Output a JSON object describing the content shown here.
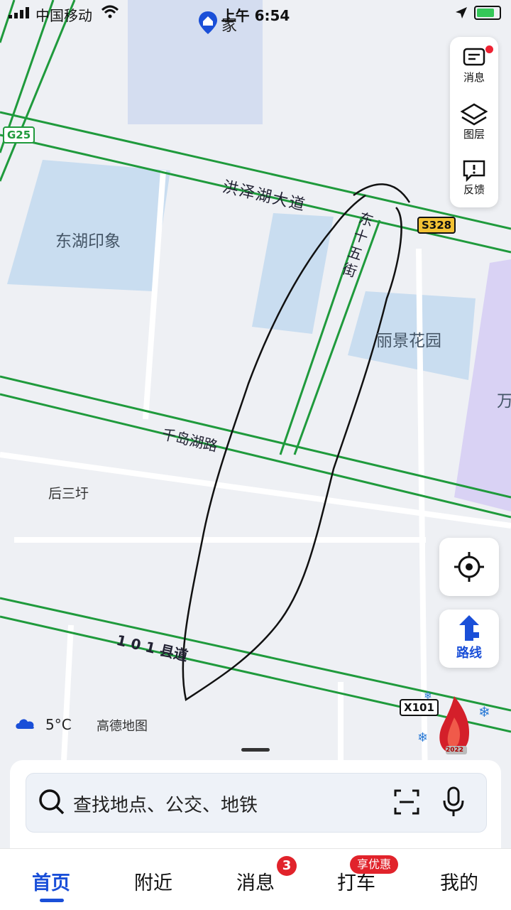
{
  "status": {
    "carrier": "中国移动",
    "time": "上午 6:54"
  },
  "map": {
    "home_label": "家",
    "roads": {
      "hongzehu": "洪泽湖大道",
      "dong15": "东十五街",
      "qiandaohu": "千岛湖路",
      "county101": "1 0 1 县道"
    },
    "places": {
      "donghu": "东湖印象",
      "lijing": "丽景花园",
      "housanyu": "后三圩",
      "wan": "万"
    },
    "signs": {
      "g25": "G25",
      "s328": "S328",
      "x101": "X101"
    },
    "event_logo_year": "2022"
  },
  "right_panel": {
    "messages": "消息",
    "layers": "图层",
    "feedback": "反馈"
  },
  "route_button": "路线",
  "weather": {
    "temp": "5°C"
  },
  "map_logo": "高德地图",
  "search": {
    "placeholder": "查找地点、公交、地铁"
  },
  "tabs": [
    {
      "label": "首页"
    },
    {
      "label": "附近"
    },
    {
      "label": "消息"
    },
    {
      "label": "打车"
    },
    {
      "label": "我的"
    }
  ],
  "badges": {
    "messages": "3",
    "taxi_promo": "享优惠"
  },
  "colors": {
    "accent": "#1a4fd8",
    "road_green": "#1f9a3c",
    "water": "#c9ddf0",
    "badge": "#e1232b"
  }
}
